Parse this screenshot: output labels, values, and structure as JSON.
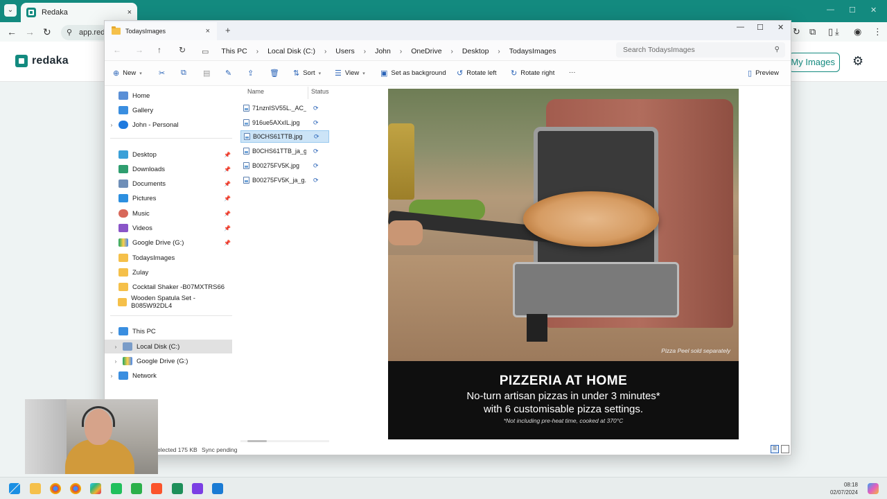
{
  "browser": {
    "tab_title": "Redaka",
    "tab_close": "×",
    "url_fragment": "app.red",
    "menu_icon": "chevron-down-icon"
  },
  "app": {
    "logo_text": "redaka",
    "my_images_label": "My Images",
    "settings_icon": "⚙",
    "brand_color": "#138a7f"
  },
  "explorer": {
    "tab_title": "TodaysImages",
    "tab_close": "×",
    "new_tab": "+",
    "win_controls": [
      "—",
      "☐",
      "✕"
    ],
    "breadcrumb": [
      "This PC",
      "Local Disk (C:)",
      "Users",
      "John",
      "OneDrive",
      "Desktop",
      "TodaysImages"
    ],
    "search_placeholder": "Search TodaysImages",
    "commands": {
      "new": "New",
      "sort": "Sort",
      "view": "View",
      "set_background": "Set as background",
      "rotate_left": "Rotate left",
      "rotate_right": "Rotate right",
      "more": "···",
      "preview": "Preview"
    },
    "nav": {
      "top": [
        {
          "label": "Home",
          "icon": "home-icon"
        },
        {
          "label": "Gallery",
          "icon": "gallery-icon"
        },
        {
          "label": "John - Personal",
          "icon": "onedrive-icon"
        }
      ],
      "quick": [
        {
          "label": "Desktop",
          "icon": "desktop-icon"
        },
        {
          "label": "Downloads",
          "icon": "download-icon"
        },
        {
          "label": "Documents",
          "icon": "documents-icon"
        },
        {
          "label": "Pictures",
          "icon": "pictures-icon"
        },
        {
          "label": "Music",
          "icon": "music-icon"
        },
        {
          "label": "Videos",
          "icon": "videos-icon"
        },
        {
          "label": "Google Drive (G:)",
          "icon": "google-drive-icon"
        },
        {
          "label": "TodaysImages",
          "icon": "folder-icon"
        },
        {
          "label": "Zulay",
          "icon": "folder-icon"
        },
        {
          "label": "Cocktail Shaker -B07MXTRS66",
          "icon": "folder-icon"
        },
        {
          "label": "Wooden Spatula Set - B085W92DL4",
          "icon": "folder-icon"
        }
      ],
      "this_pc": "This PC",
      "local_disk": "Local Disk (C:)",
      "google_drive": "Google Drive (G:)",
      "network": "Network"
    },
    "columns": {
      "name": "Name",
      "status": "Status"
    },
    "files": [
      {
        "name": "71nznISV55L._AC_...",
        "selected": false
      },
      {
        "name": "916ue5AXxIL.jpg",
        "selected": false
      },
      {
        "name": "B0CHS61TTB.jpg",
        "selected": true
      },
      {
        "name": "B0CHS61TTB_ja_g...",
        "selected": false
      },
      {
        "name": "B00275FV5K.jpg",
        "selected": false
      },
      {
        "name": "B00275FV5K_ja_g...",
        "selected": false
      }
    ],
    "status_selected": "elected  175 KB",
    "status_sync": "Sync pending"
  },
  "preview": {
    "small_caption": "Pizza Peel sold separately",
    "headline": "PIZZERIA AT HOME",
    "line1": "No-turn artisan pizzas in under 3 minutes*",
    "line2": "with 6 customisable pizza settings.",
    "note": "*Not including pre-heat time, cooked at 370°C"
  },
  "taskbar": {
    "time": "08:18",
    "date": "02/07/2024"
  }
}
